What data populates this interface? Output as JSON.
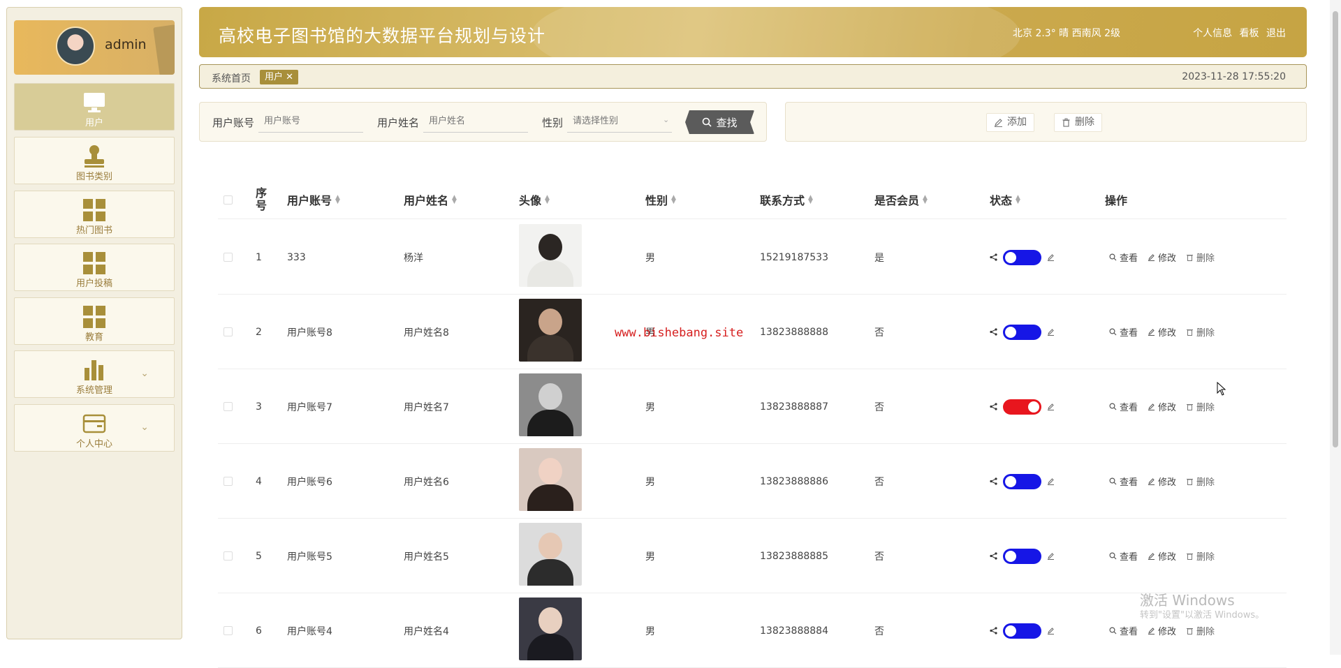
{
  "sidebar": {
    "username": "admin",
    "items": [
      {
        "label": "用户",
        "icon": "monitor-icon",
        "active": true
      },
      {
        "label": "图书类别",
        "icon": "stamp-icon"
      },
      {
        "label": "热门图书",
        "icon": "grid-icon"
      },
      {
        "label": "用户投稿",
        "icon": "grid-icon"
      },
      {
        "label": "教育",
        "icon": "grid-icon"
      },
      {
        "label": "系统管理",
        "icon": "bar-chart-icon",
        "expandable": true
      },
      {
        "label": "个人中心",
        "icon": "card-icon",
        "expandable": true
      }
    ]
  },
  "header": {
    "title": "高校电子图书馆的大数据平台规划与设计",
    "weather": "北京  2.3°  晴  西南风  2级",
    "links": [
      "个人信息",
      "看板",
      "退出"
    ]
  },
  "breadcrumb": {
    "home": "系统首页",
    "tab": "用户",
    "tab_close": "✕",
    "datetime": "2023-11-28 17:55:20"
  },
  "search": {
    "account_label": "用户账号",
    "account_placeholder": "用户账号",
    "name_label": "用户姓名",
    "name_placeholder": "用户姓名",
    "gender_label": "性别",
    "gender_placeholder": "请选择性别",
    "button": "查找"
  },
  "actions": {
    "add": "添加",
    "delete": "删除"
  },
  "table": {
    "headers": {
      "index": "序号",
      "account": "用户账号",
      "name": "用户姓名",
      "avatar": "头像",
      "gender": "性别",
      "phone": "联系方式",
      "member": "是否会员",
      "status": "状态",
      "ops": "操作"
    },
    "op_labels": {
      "view": "查看",
      "edit": "修改",
      "delete": "删除"
    },
    "rows": [
      {
        "index": "1",
        "account": "333",
        "name": "杨洋",
        "gender": "男",
        "phone": "15219187533",
        "member": "是",
        "status_on": false,
        "avatar_bg": "#f2f2f0",
        "avatar_fg": "#e8e8e4",
        "avatar_head": "#2b2623"
      },
      {
        "index": "2",
        "account": "用户账号8",
        "name": "用户姓名8",
        "gender": "男",
        "phone": "13823888888",
        "member": "否",
        "status_on": false,
        "avatar_bg": "#2a2420",
        "avatar_fg": "#3a322c",
        "avatar_head": "#c9a48a"
      },
      {
        "index": "3",
        "account": "用户账号7",
        "name": "用户姓名7",
        "gender": "男",
        "phone": "13823888887",
        "member": "否",
        "status_on": true,
        "avatar_bg": "#8c8c8c",
        "avatar_fg": "#1c1c1c",
        "avatar_head": "#d0d0d0"
      },
      {
        "index": "4",
        "account": "用户账号6",
        "name": "用户姓名6",
        "gender": "男",
        "phone": "13823888886",
        "member": "否",
        "status_on": false,
        "avatar_bg": "#d9c9c0",
        "avatar_fg": "#2a201c",
        "avatar_head": "#f0d2c4"
      },
      {
        "index": "5",
        "account": "用户账号5",
        "name": "用户姓名5",
        "gender": "男",
        "phone": "13823888885",
        "member": "否",
        "status_on": false,
        "avatar_bg": "#dcdcdc",
        "avatar_fg": "#2c2c2c",
        "avatar_head": "#e6c8b4"
      },
      {
        "index": "6",
        "account": "用户账号4",
        "name": "用户姓名4",
        "gender": "男",
        "phone": "13823888884",
        "member": "否",
        "status_on": false,
        "avatar_bg": "#3a3a44",
        "avatar_fg": "#1a1a20",
        "avatar_head": "#e8d0c0"
      }
    ]
  },
  "watermark": "www.bishebang.site",
  "os_notice": {
    "title": "激活 Windows",
    "subtitle": "转到\"设置\"以激活 Windows。"
  },
  "colors": {
    "accent": "#c8a846",
    "tab": "#a88f3a",
    "toggle_off": "#1616e6",
    "toggle_on": "#e8161e"
  }
}
